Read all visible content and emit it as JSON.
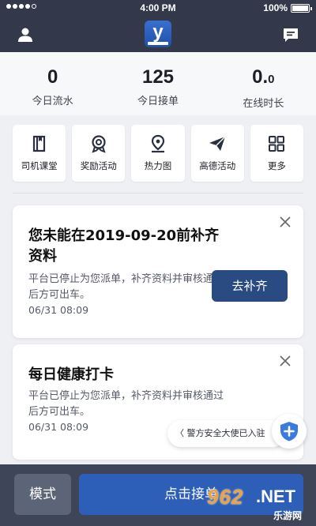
{
  "status_bar": {
    "time": "4:00 PM",
    "battery": "100%"
  },
  "header": {
    "logo_letter": "y"
  },
  "stats": [
    {
      "value": "0",
      "value_suffix": "",
      "label": "今日流水"
    },
    {
      "value": "125",
      "value_suffix": "",
      "label": "今日接单"
    },
    {
      "value": "0.",
      "value_suffix": "0",
      "label": "在线时长"
    }
  ],
  "actions": [
    {
      "label": "司机课堂",
      "icon": "book-icon"
    },
    {
      "label": "奖励活动",
      "icon": "medal-icon"
    },
    {
      "label": "热力图",
      "icon": "location-pin-icon"
    },
    {
      "label": "高德活动",
      "icon": "paper-plane-icon"
    },
    {
      "label": "更多",
      "icon": "grid-icon"
    }
  ],
  "cards": [
    {
      "title": "您未能在2019-09-20前补齐资料",
      "desc": "平台已停止为您派单，补齐资料并审核通过后方可出车。",
      "time": "06/31 08:09",
      "cta": "去补齐"
    },
    {
      "title": "每日健康打卡",
      "desc": "平台已停止为您派单，补齐资料并审核通过后方可出车。",
      "time": "06/31 08:09"
    }
  ],
  "police": {
    "text": "〈 警方安全大使已入驻"
  },
  "bottom": {
    "mode_label": "模式",
    "accept_label": "点击接单"
  },
  "watermark": {
    "num": "962",
    "net": ".NET",
    "site": "乐游网"
  },
  "colors": {
    "header": "#33394b",
    "accent": "#2e5fb8",
    "cta": "#2a4a82",
    "bottom_bar": "#3e4558"
  }
}
